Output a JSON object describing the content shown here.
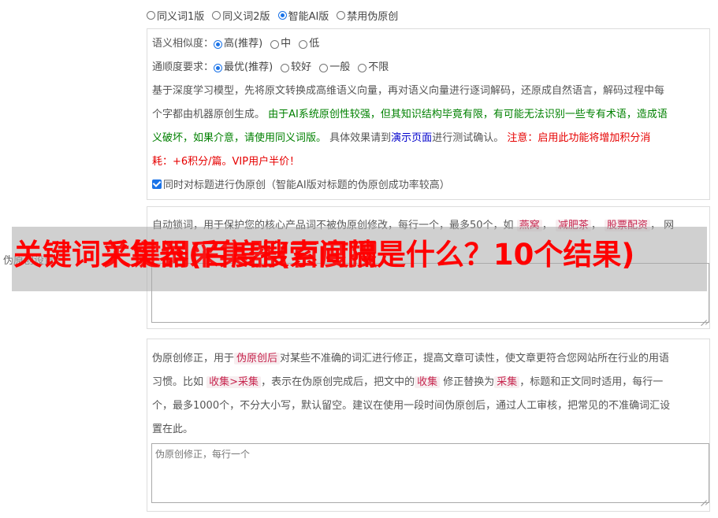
{
  "version_options": {
    "items": [
      {
        "label": "同义词1版",
        "selected": false
      },
      {
        "label": "同义词2版",
        "selected": false
      },
      {
        "label": "智能AI版",
        "selected": true
      },
      {
        "label": "禁用伪原创",
        "selected": false
      }
    ]
  },
  "similarity": {
    "label": "语义相似度：",
    "options": [
      {
        "label": "高(推荐)",
        "selected": true
      },
      {
        "label": "中",
        "selected": false
      },
      {
        "label": "低",
        "selected": false
      }
    ]
  },
  "fluency": {
    "label": "通顺度要求：",
    "options": [
      {
        "label": "最优(推荐)",
        "selected": true
      },
      {
        "label": "较好",
        "selected": false
      },
      {
        "label": "一般",
        "selected": false
      },
      {
        "label": "不限",
        "selected": false
      }
    ]
  },
  "description": {
    "line1": "基于深度学习模型，先将原文转换成高维语义向量，再对语义向量进行逐词解码，还原成自然语言，解码过程中每",
    "line2a": "个字都由机器原创生成。",
    "line2b": "由于AI系统原创性较强，但其知识结构毕竟有限，有可能无法识别一些专有术语，造成语",
    "line3a": "义破坏，如果介意，请使用同义词版。",
    "line3b": "具体效果请到",
    "line3c": "演示页面",
    "line3d": "进行测试确认。",
    "line3e": "注意：启用此功能将增加积分消",
    "line4": "耗：+6积分/篇。VIP用户半价！"
  },
  "title_check": {
    "label": "同时对标题进行伪原创（智能AI版对标题的伪原创成功率较高）",
    "checked": true
  },
  "lock_words": {
    "desc": "自动锁词，用于保护您的核心产品词不被伪原创修改，每行一个，最多50个，如",
    "tags": [
      "燕窝",
      "减肥茶",
      "股票配资"
    ],
    "tail": "网"
  },
  "side_label": "伪原创设置",
  "correction": {
    "line1a": "伪原创修正，用于",
    "tag1": "伪原创后",
    "line1b": "对某些不准确的词汇进行修正，提高文章可读性，使文章更符合您网站所在行业的用语",
    "line2a": "习惯。比如",
    "tag2": "收集>采集",
    "line2b": "，表示在伪原创完成后，把文中的",
    "tag3": "收集",
    "line2c": "修正替换为",
    "tag4": "采集",
    "line2d": "，标题和正文同时适用，每行一",
    "line3": "个，最多1000个，不分大小写，默认留空。建议在使用一段时间伪原创后，通过人工审核，把常见的不准确词汇设",
    "line4": "置在此。",
    "placeholder": "伪原创修正，每行一个"
  },
  "overlay": {
    "title": "关键词采集器(百度搜索间隔是什么？10个结果)",
    "ghost": "关键词采集器(百度搜"
  },
  "colors": {
    "accent": "#1a73e8",
    "green_text": "#008000",
    "red_text": "#e60000",
    "link": "#0000cc",
    "overlay_red": "#ff0000"
  }
}
